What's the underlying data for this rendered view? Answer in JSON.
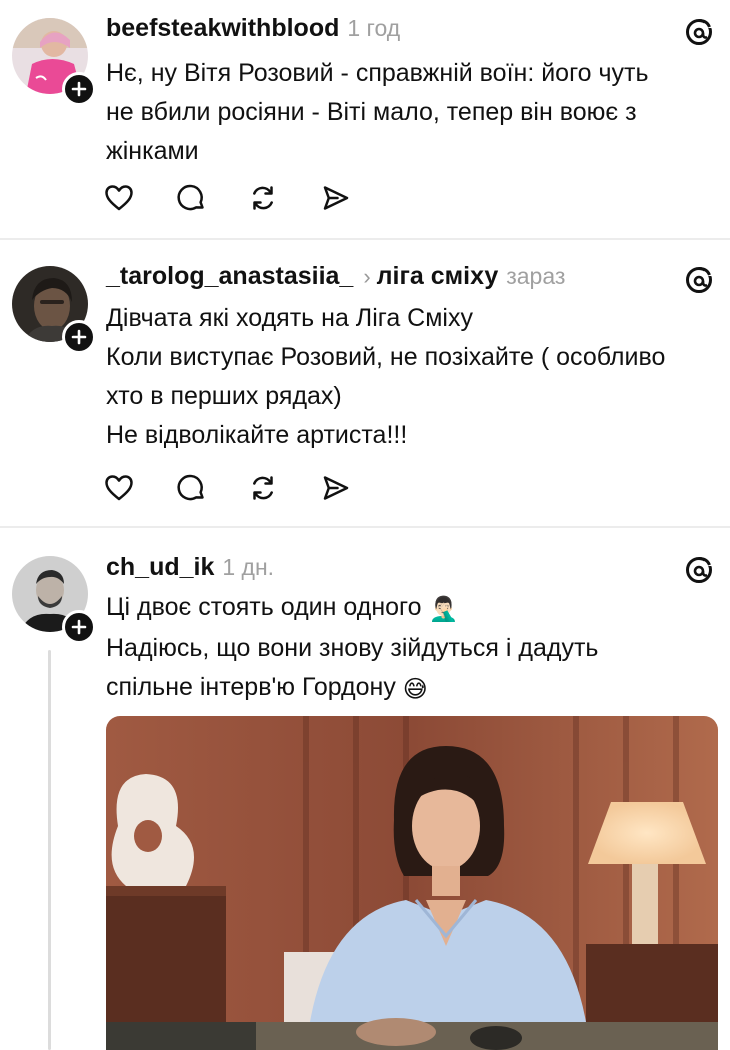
{
  "posts": [
    {
      "username": "beefsteakwithblood",
      "time": "1 год",
      "lines": [
        "Нє, ну Вітя Розовий - справжній воїн: його чуть",
        "не вбили росіяни - Віті мало, тепер він воює з",
        "жінками"
      ]
    },
    {
      "username": "_tarolog_anastasiia_",
      "chevron": "›",
      "community": "ліга сміху",
      "time": "зараз",
      "lines": [
        "Дівчата які ходять на  Ліга Сміху",
        "Коли виступає Розовий, не позіхайте ( особливо",
        "хто в перших рядах)",
        "Не відволікайте артиста!!!"
      ]
    },
    {
      "username": "ch_ud_ik",
      "time": "1 дн.",
      "lines": [
        "Ці двоє стоять один одного",
        "Надіюсь, що вони знову зійдуться і дадуть",
        "спільне інтерв'ю Гордону"
      ],
      "emoji_1": "🤦🏻‍♂️",
      "emoji_2": "😅"
    }
  ],
  "icons": [
    "heart-icon",
    "comment-icon",
    "repost-icon",
    "share-icon",
    "threads-icon",
    "plus-icon"
  ],
  "colors": {
    "text": "#111111",
    "muted": "#a0a0a0",
    "divider": "#ececec"
  }
}
